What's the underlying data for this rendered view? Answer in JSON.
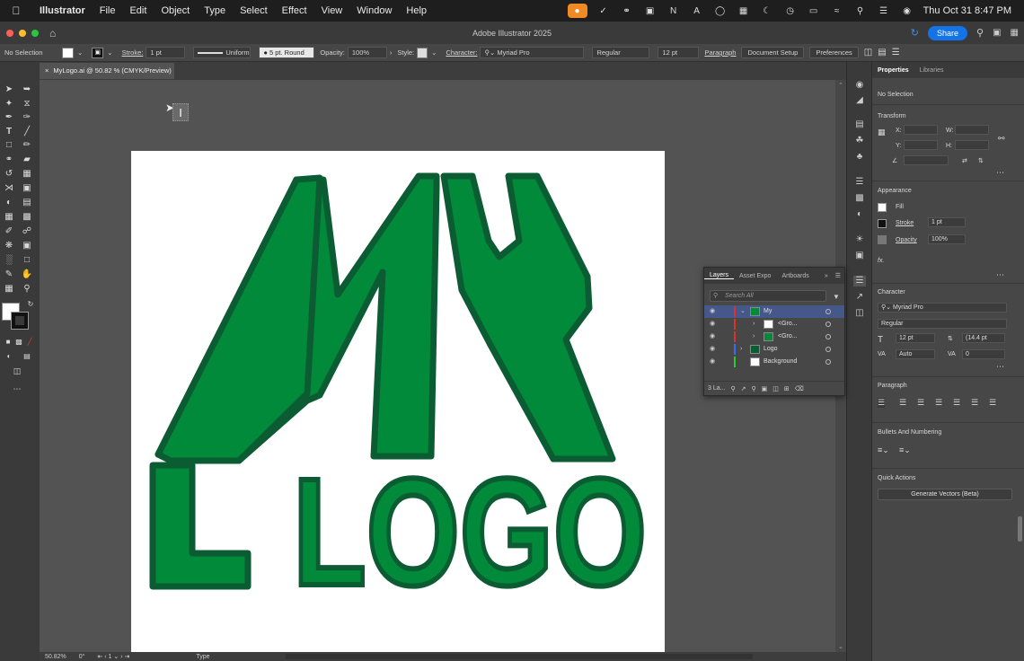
{
  "menubar": {
    "apple": "",
    "items": [
      "Illustrator",
      "File",
      "Edit",
      "Object",
      "Type",
      "Select",
      "Effect",
      "View",
      "Window",
      "Help"
    ],
    "clock": "Thu Oct 31  8:47 PM"
  },
  "window": {
    "title": "Adobe Illustrator 2025",
    "share_label": "Share"
  },
  "control_bar": {
    "selection": "No Selection",
    "stroke_label": "Stroke:",
    "stroke_weight": "1 pt",
    "stroke_profile": "Uniform",
    "brush": "5 pt. Round",
    "opacity_label": "Opacity:",
    "opacity": "100%",
    "style_label": "Style:",
    "character_label": "Character:",
    "font": "Myriad Pro",
    "font_style": "Regular",
    "font_size": "12 pt",
    "paragraph": "Paragraph",
    "document_setup": "Document Setup",
    "preferences": "Preferences"
  },
  "document": {
    "tab_label": "MyLogo.ai @ 50.82 % (CMYK/Preview)"
  },
  "artwork": {
    "fill_color": "#008a3a",
    "stroke_color": "#0b5c32",
    "bottom_text": "LOGO"
  },
  "status": {
    "zoom": "50.82%",
    "rotation": "0°",
    "artboard": "1",
    "tool": "Type"
  },
  "layers_panel": {
    "tabs": [
      "Layers",
      "Asset Expo",
      "Artboards"
    ],
    "search_placeholder": "Search All",
    "rows": [
      {
        "name": "My",
        "color": "#e0302a"
      },
      {
        "name": "<Gro...",
        "color": "#e0302a"
      },
      {
        "name": "<Gro...",
        "color": "#e0302a"
      },
      {
        "name": "Logo",
        "color": "#3a6cf0"
      },
      {
        "name": "Background",
        "color": "#2ec72e"
      }
    ],
    "footer_count": "3 La..."
  },
  "properties": {
    "tabs": [
      "Properties",
      "Libraries"
    ],
    "no_selection": "No Selection",
    "transform": {
      "title": "Transform",
      "x_label": "X:",
      "y_label": "Y:",
      "w_label": "W:",
      "h_label": "H:"
    },
    "appearance": {
      "title": "Appearance",
      "fill": "Fill",
      "stroke": "Stroke",
      "stroke_value": "1 pt",
      "opacity": "Opacity",
      "opacity_value": "100%",
      "fx": "fx."
    },
    "character": {
      "title": "Character",
      "font": "Myriad Pro",
      "style": "Regular",
      "size": "12 pt",
      "leading": "(14.4 pt",
      "kerning": "Auto",
      "tracking": "0"
    },
    "paragraph": {
      "title": "Paragraph"
    },
    "bullets": {
      "title": "Bullets And Numbering"
    },
    "quick_actions": {
      "title": "Quick Actions",
      "button": "Generate Vectors (Beta)"
    }
  }
}
